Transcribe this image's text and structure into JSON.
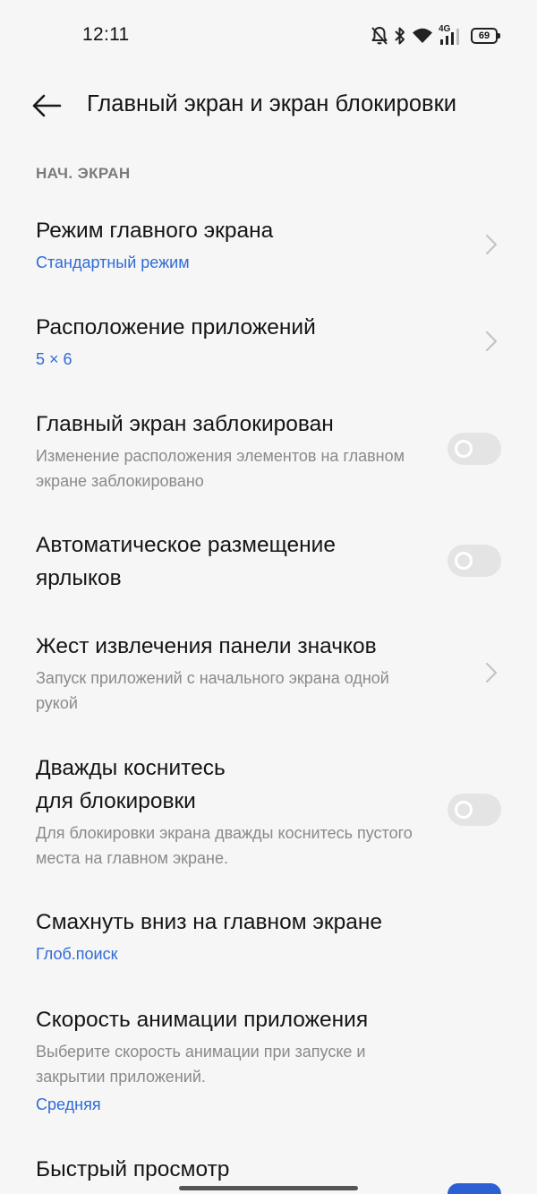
{
  "status_bar": {
    "time": "12:11",
    "network": "4G",
    "battery": "69",
    "icons": [
      "bell-off-icon",
      "bluetooth-icon",
      "wifi-icon",
      "signal-icon",
      "battery-icon"
    ]
  },
  "header": {
    "back_icon": "arrow-left-icon",
    "title": "Главный экран и экран блокировки"
  },
  "section": {
    "title": "НАЧ. ЭКРАН"
  },
  "settings": [
    {
      "title": "Режим главного экрана",
      "value": "Стандартный режим",
      "control": "chevron"
    },
    {
      "title": "Расположение приложений",
      "value": "5 × 6",
      "control": "chevron"
    },
    {
      "title": "Главный экран заблокирован",
      "description": "Изменение расположения элементов на главном экране заблокировано",
      "control": "toggle",
      "on": false
    },
    {
      "title": "Автоматическое размещение\nярлыков",
      "control": "toggle",
      "on": false
    },
    {
      "title": "Жест извлечения панели значков",
      "description": "Запуск приложений с начального экрана одной рукой",
      "control": "chevron"
    },
    {
      "title": "Дважды коснитесь\nдля блокировки",
      "description": "Для блокировки экрана дважды коснитесь пустого места на главном экране.",
      "control": "toggle",
      "on": false
    },
    {
      "title": "Смахнуть вниз на главном экране",
      "value": "Глоб.поиск",
      "control": "chevron"
    },
    {
      "title": "Скорость анимации приложения",
      "description": "Выберите скорость анимации при запуске и закрытии приложений.",
      "value": "Средняя",
      "control": "none"
    },
    {
      "title": "Быстрый просмотр",
      "control": "toggle",
      "on": true
    }
  ],
  "colors": {
    "background": "#f6f6f6",
    "accent": "#2f6bd9",
    "secondary_text": "#8a8a8a"
  }
}
